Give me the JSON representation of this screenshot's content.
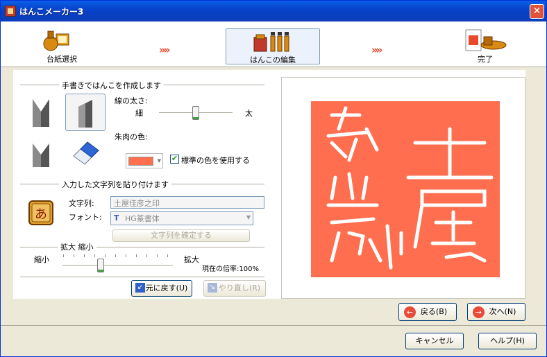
{
  "window": {
    "title": "はんこメーカー3",
    "close_glyph": "✕"
  },
  "steps": [
    {
      "label": "台紙選択"
    },
    {
      "label": "はんこの編集"
    },
    {
      "label": "完了"
    }
  ],
  "step_arrow": "»»",
  "handwrite": {
    "title": "手書きではんこを作成します",
    "line_width_label": "線の太さ:",
    "thin": "細",
    "thick": "太",
    "line_width_level": 0.5,
    "color_label": "朱肉の色:",
    "color": "#ff6e4e",
    "use_standard_color": "標準の色を使用する",
    "use_standard_checked": true
  },
  "paste": {
    "title": "入力した文字列を貼り付けます",
    "string_label": "文字列:",
    "string_value": "土屋佳彦之印",
    "font_label": "フォント:",
    "font_value": "HG篆書体",
    "confirm_button": "文字列を確定する"
  },
  "zoom": {
    "title": "拡大 縮小",
    "shrink": "縮小",
    "enlarge": "拡大",
    "current": "現在の倍率:100%",
    "level": 0.35
  },
  "undo_button": "元に戻す(U)",
  "redo_button": "やり直し(R)",
  "back_button": "戻る(B)",
  "next_button": "次へ(N)",
  "cancel_button": "キャンセル",
  "help_button": "ヘルプ(H)",
  "colors": {
    "titlebar": "#0842c8",
    "stamp": "#ff6e4e",
    "arrow": "#e84a2a"
  }
}
